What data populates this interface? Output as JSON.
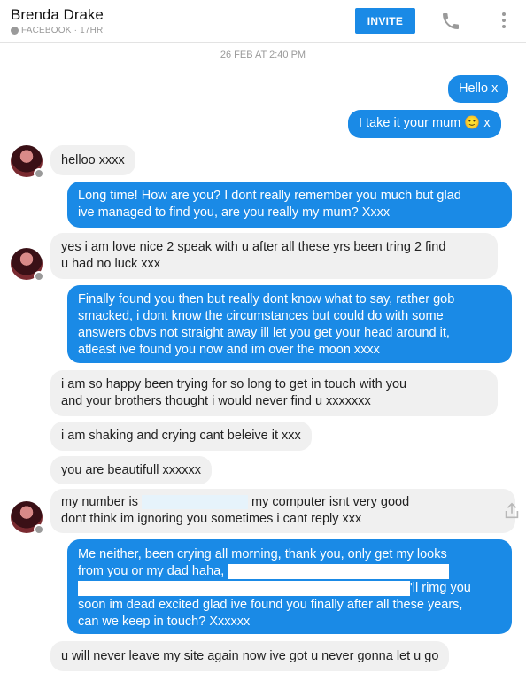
{
  "header": {
    "contact_name": "Brenda Drake",
    "source": "FACEBOOK · 17HR",
    "invite_label": "INVITE"
  },
  "timestamp": "26 FEB AT 2:40 PM",
  "messages": [
    {
      "from": "me",
      "lines": [
        "Hello x"
      ]
    },
    {
      "from": "me",
      "lines": [
        "I take it your mum 🙂 x"
      ]
    },
    {
      "from": "them",
      "lines": [
        "helloo xxxx"
      ]
    },
    {
      "from": "me",
      "lines": [
        "Long time! How are you? I dont really remember you much but glad",
        "ive managed to find you, are you really my mum? Xxxx"
      ]
    },
    {
      "from": "them",
      "lines": [
        "yes i am  love nice 2 speak with u after all these yrs been tring 2 find",
        "u had no luck xxx"
      ]
    },
    {
      "from": "me",
      "lines": [
        "Finally found you then but really dont know what to say, rather gob",
        "smacked, i dont know the circumstances but could do with some",
        "answers obvs not straight away ill let you get your head around it,",
        "atleast ive found you now and im over the moon xxxx"
      ]
    },
    {
      "from": "them",
      "lines": [
        "i am so happy been trying for so long to get in touch with you",
        "and your brothers thought i would never find u xxxxxxx"
      ]
    },
    {
      "from": "them",
      "lines": [
        "i am shaking and crying cant beleive it xxx"
      ]
    },
    {
      "from": "them",
      "lines": [
        "you are beautifull xxxxxx"
      ]
    },
    {
      "from": "them",
      "lines": [
        "my number is",
        "my computer isnt very good",
        "dont think im ignoring you sometimes i cant reply xxx"
      ]
    },
    {
      "from": "me",
      "lines": [
        "Me neither, been crying all morning, thank you, only get my looks",
        "from you or my dad haha,",
        "'ll rimg you",
        "soon im dead excited glad ive found you finally after all these years,",
        "can we keep in touch? Xxxxxx"
      ]
    },
    {
      "from": "them",
      "lines": [
        "u will never leave my site again now ive got u never gonna let u go"
      ]
    }
  ]
}
